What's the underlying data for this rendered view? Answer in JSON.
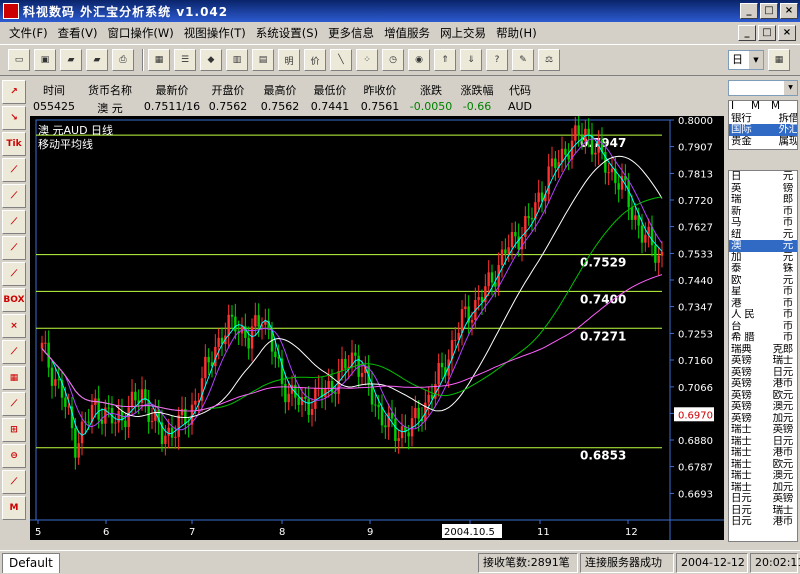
{
  "window": {
    "title": "科视数码 外汇宝分析系统 v1.042",
    "buttons": [
      "_",
      "□",
      "×"
    ]
  },
  "menu": [
    "文件(F)",
    "查看(V)",
    "窗口操作(W)",
    "视图操作(T)",
    "系统设置(S)",
    "更多信息",
    "增值服务",
    "网上交易",
    "帮助(H)"
  ],
  "toolbar": {
    "period": "日"
  },
  "left_tools": [
    "↗",
    "↘",
    "Tik",
    "⟋",
    "⟋",
    "⟋",
    "⟋",
    "⟋",
    "BOX",
    "×",
    "⟋",
    "▦",
    "⟋",
    "⊞",
    "⊖",
    "⟋",
    "M"
  ],
  "quote": {
    "headers": [
      "时间",
      "货币名称",
      "最新价",
      "开盘价",
      "最高价",
      "最低价",
      "昨收价",
      "涨跌",
      "涨跌幅",
      "代码"
    ],
    "values": [
      "055425",
      "澳 元",
      "0.7511/16",
      "0.7562",
      "0.7562",
      "0.7441",
      "0.7561",
      "-0.0050",
      "-0.66",
      "AUD"
    ]
  },
  "chart_labels": {
    "title": "澳    元AUD  日线",
    "indicator": "移动平均线"
  },
  "chart_data": {
    "type": "candlestick",
    "y_ticks": [
      "0.8000",
      "0.7907",
      "0.7813",
      "0.7720",
      "0.7627",
      "0.7533",
      "0.7440",
      "0.7347",
      "0.7253",
      "0.7160",
      "0.7066",
      "0.6973",
      "0.6880",
      "0.6787",
      "0.6693"
    ],
    "ylim": [
      0.66,
      0.8
    ],
    "x_ticks": [
      "5",
      "6",
      "7",
      "8",
      "9",
      "2004.10.5",
      "11",
      "12"
    ],
    "current_price_label": "0.6970",
    "levels": [
      {
        "label": "0.7947",
        "value": 0.7947
      },
      {
        "label": "0.7529",
        "value": 0.7529
      },
      {
        "label": "0.7400",
        "value": 0.74
      },
      {
        "label": "0.7271",
        "value": 0.7271
      },
      {
        "label": "0.6853",
        "value": 0.6853
      }
    ],
    "line_colors": {
      "up": "#ff3030",
      "down": "#00d000",
      "ma1": "#ffffff",
      "ma2": "#00ffff",
      "ma3": "#b040ff",
      "ma4": "#00c000",
      "ma5": "#ff60ff",
      "level": "#c0ff40"
    }
  },
  "right_panel": {
    "categories": [
      [
        "I",
        "M",
        "M"
      ],
      [
        "银行",
        "拆借"
      ],
      [
        "国际",
        "外汇"
      ],
      [
        "贵金",
        "属现"
      ]
    ],
    "selected_category": 2,
    "items": [
      [
        "日",
        "元"
      ],
      [
        "英",
        "镑"
      ],
      [
        "瑞",
        "郎"
      ],
      [
        "新",
        "币"
      ],
      [
        "马",
        "币"
      ],
      [
        "纽",
        "元"
      ],
      [
        "澳",
        "元"
      ],
      [
        "加",
        "元"
      ],
      [
        "泰",
        "铢"
      ],
      [
        "欧",
        "元"
      ],
      [
        "星",
        "币"
      ],
      [
        "港",
        "币"
      ],
      [
        "人 民",
        "币"
      ],
      [
        "台",
        "币"
      ],
      [
        "希 腊",
        "币"
      ],
      [
        "瑞典",
        "克郎"
      ],
      [
        "英镑",
        "瑞士"
      ],
      [
        "英镑",
        "日元"
      ],
      [
        "英镑",
        "港币"
      ],
      [
        "英镑",
        "欧元"
      ],
      [
        "英镑",
        "澳元"
      ],
      [
        "英镑",
        "加元"
      ],
      [
        "瑞士",
        "英镑"
      ],
      [
        "瑞士",
        "日元"
      ],
      [
        "瑞士",
        "港币"
      ],
      [
        "瑞士",
        "欧元"
      ],
      [
        "瑞士",
        "澳元"
      ],
      [
        "瑞士",
        "加元"
      ],
      [
        "日元",
        "英镑"
      ],
      [
        "日元",
        "瑞士"
      ],
      [
        "日元",
        "港币"
      ]
    ],
    "selected_item": 6
  },
  "status": {
    "tab": "Default",
    "received": "接收笔数:2891笔",
    "connection": "连接服务器成功",
    "date": "2004-12-12",
    "time": "20:02:11"
  }
}
